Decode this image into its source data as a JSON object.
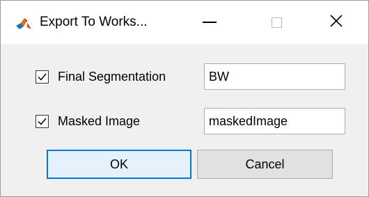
{
  "window": {
    "title": "Export To Works...",
    "app_icon": "matlab-logo-icon"
  },
  "titlebar_buttons": {
    "minimize": "minimize-icon",
    "maximize": "maximize-icon",
    "close": "close-icon",
    "close_glyph": "✕"
  },
  "rows": [
    {
      "checked": true,
      "label": "Final Segmentation",
      "value": "BW"
    },
    {
      "checked": true,
      "label": "Masked Image",
      "value": "maskedImage"
    }
  ],
  "buttons": {
    "ok_label": "OK",
    "cancel_label": "Cancel"
  },
  "colors": {
    "accent": "#0078d7",
    "ok_fill": "#e5f1fb"
  }
}
